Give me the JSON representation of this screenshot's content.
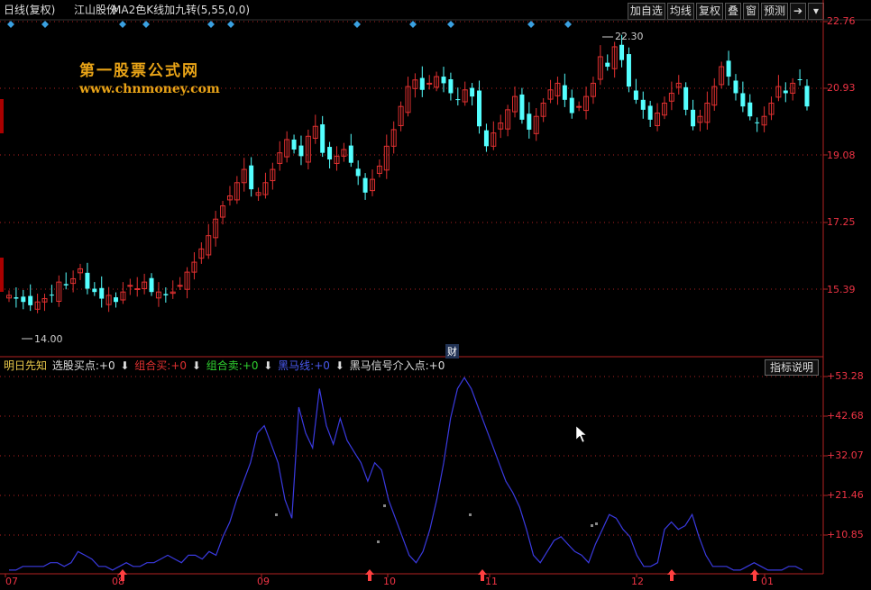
{
  "header": {
    "period": "日线(复权)",
    "stock": "江山股份",
    "indicator": "MA2色K线加九转(5,55,0,0)"
  },
  "toolbar": {
    "buttons": [
      "加自选",
      "均线",
      "复权",
      "叠",
      "窗",
      "预测"
    ],
    "icons": [
      "arrow-out-icon",
      "dropdown-icon"
    ]
  },
  "watermark": {
    "title": "第一股票公式网",
    "url": "www.chnmoney.com"
  },
  "price_axis": [
    "22.76",
    "20.93",
    "19.08",
    "17.25",
    "15.39"
  ],
  "annotations": {
    "high": "22.30",
    "low": "14.00",
    "cai": "财"
  },
  "indicator_bar": {
    "name": "明日先知",
    "items": [
      {
        "label": "选股买点:",
        "value": "+0",
        "color": "#dddddd"
      },
      {
        "label": "组合买:",
        "value": "+0",
        "color": "#e03030"
      },
      {
        "label": "组合卖:",
        "value": "+0",
        "color": "#30d030"
      },
      {
        "label": "黑马线:",
        "value": "+0",
        "color": "#4a5af0"
      },
      {
        "label": "黑马信号介入点:",
        "value": "+0",
        "color": "#dddddd"
      }
    ],
    "explain_button": "指标说明"
  },
  "indicator_axis": [
    "+53.28",
    "+42.68",
    "+32.07",
    "+21.46",
    "+10.85"
  ],
  "x_axis": [
    "07",
    "08",
    "09",
    "10",
    "11",
    "12",
    "01"
  ],
  "colors": {
    "up": "#e03030",
    "down": "#54ffff",
    "line": "#3a3ae0",
    "axis": "#b22222",
    "diamond": "#3aa0e0"
  },
  "chart_data": {
    "type": "candlestick",
    "price_ylim": [
      13.3,
      22.76
    ],
    "ohlc_note": "daily K line, approximated",
    "indicator_series": {
      "name": "黑马线",
      "ylim": [
        0,
        53.28
      ],
      "values": [
        1,
        1,
        2,
        2,
        2,
        2,
        3,
        3,
        2,
        3,
        6,
        5,
        4,
        2,
        2,
        1,
        2,
        3,
        2,
        2,
        3,
        3,
        4,
        5,
        4,
        3,
        5,
        5,
        4,
        6,
        5,
        10,
        14,
        20,
        25,
        30,
        38,
        40,
        35,
        30,
        20,
        15,
        45,
        38,
        34,
        50,
        40,
        35,
        42,
        36,
        33,
        30,
        25,
        30,
        28,
        20,
        15,
        10,
        5,
        3,
        6,
        12,
        20,
        30,
        42,
        50,
        53,
        50,
        45,
        40,
        35,
        30,
        25,
        22,
        18,
        12,
        5,
        3,
        6,
        9,
        10,
        8,
        6,
        5,
        3,
        8,
        12,
        16,
        15,
        12,
        10,
        5,
        2,
        2,
        3,
        12,
        14,
        12,
        13,
        16,
        10,
        5,
        2,
        2,
        2,
        1,
        1,
        2,
        3,
        2,
        1,
        1,
        1,
        2,
        2,
        1
      ]
    }
  }
}
